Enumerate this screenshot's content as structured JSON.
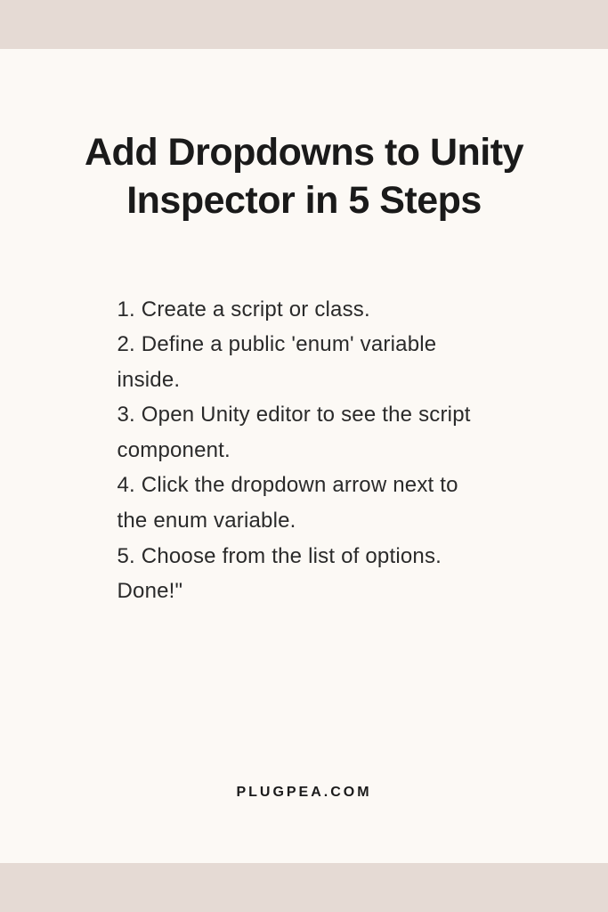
{
  "title": "Add Dropdowns to Unity Inspector in 5 Steps",
  "steps": [
    "1. Create a script or class.",
    "2. Define a public 'enum' variable inside.",
    "3. Open Unity editor to see the script component.",
    "4. Click the dropdown arrow next to the enum variable.",
    "5. Choose from the list of options. Done!\""
  ],
  "footer": "PLUGPEA.COM"
}
